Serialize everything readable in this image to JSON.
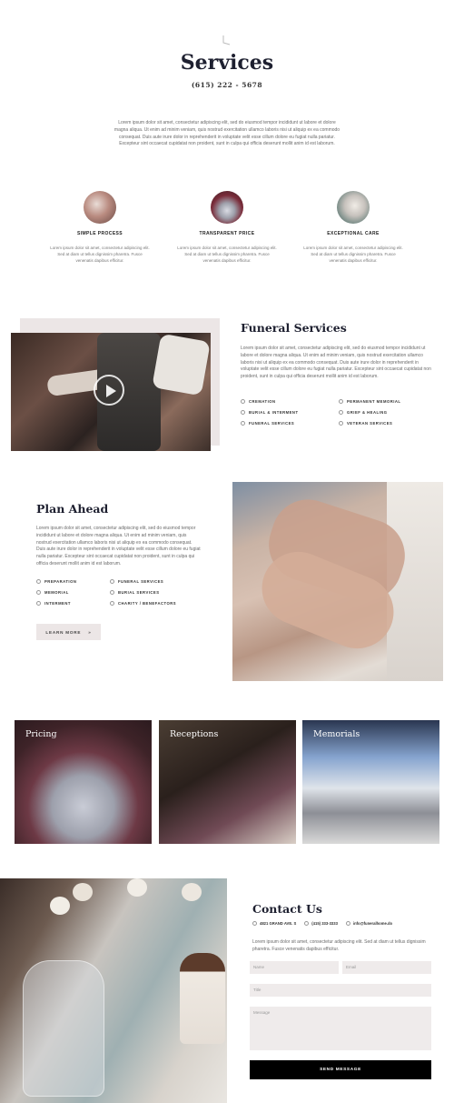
{
  "header": {
    "title": "Services",
    "phone": "(615) 222 - 5678",
    "intro": "Lorem ipsum dolor sit amet, consectetur adipiscing elit, sed do eiusmod tempor incididunt ut labore et dolore magna aliqua. Ut enim ad minim veniam, quis nostrud exercitation ullamco laboris nisi ut aliquip ex ea commodo consequat. Duis aute irure dolor in reprehenderit in voluptate velit esse cillum dolore eu fugiat nulla pariatur. Excepteur sint occaecat cupidatat non proident, sunt in culpa qui officia deserunt mollit anim id est laborum."
  },
  "features": [
    {
      "title": "SIMPLE PROCESS",
      "text": "Lorem ipsum dolor sit amet, consectetur adipiscing elit. Sed at diam ut tellus dignissim pharetra. Fusce venenatis dapibus efficitur."
    },
    {
      "title": "TRANSPARENT PRICE",
      "text": "Lorem ipsum dolor sit amet, consectetur adipiscing elit. Sed at diam ut tellus dignissim pharetra. Fusce venenatis dapibus efficitur."
    },
    {
      "title": "EXCEPTIONAL CARE",
      "text": "Lorem ipsum dolor sit amet, consectetur adipiscing elit. Sed at diam ut tellus dignissim pharetra. Fusce venenatis dapibus efficitur."
    }
  ],
  "funeral": {
    "title": "Funeral Services",
    "text": "Lorem ipsum dolor sit amet, consectetur adipiscing elit, sed do eiusmod tempor incididunt ut labore et dolore magna aliqua. Ut enim ad minim veniam, quis nostrud exercitation ullamco laboris nisi ut aliquip ex ea commodo consequat. Duis aute irure dolor in reprehenderit in voluptate velit esse cillum dolore eu fugiat nulla pariatur. Excepteur sint occaecat cupidatat non proident, sunt in culpa qui officia deserunt mollit anim id est laborum.",
    "services": [
      "CREMATION",
      "PERMANENT MEMORIAL",
      "BURIAL & INTERMENT",
      "GRIEF & HEALING",
      "FUNERAL SERVICES",
      "VETERAN SERVICES"
    ]
  },
  "plan": {
    "title": "Plan Ahead",
    "text": "Lorem ipsum dolor sit amet, consectetur adipiscing elit, sed do eiusmod tempor incididunt ut labore et dolore magna aliqua. Ut enim ad minim veniam, quis nostrud exercitation ullamco laboris nisi ut aliquip ex ea commodo consequat. Duis aute irure dolor in reprehenderit in voluptate velit esse cillum dolore eu fugiat nulla pariatur. Excepteur sint occaecat cupidatat non proident, sunt in culpa qui officia deserunt mollit anim id est laborum.",
    "items": [
      "PREPARATION",
      "FUNERAL SERVICES",
      "MEMORIAL",
      "BURIAL SERVICES",
      "INTERMENT",
      "CHARITY / BENEFACTORS"
    ],
    "button": "LEARN MORE",
    "button_arrow": "»"
  },
  "cards": [
    {
      "label": "Pricing"
    },
    {
      "label": "Receptions"
    },
    {
      "label": "Memorials"
    }
  ],
  "contact": {
    "title": "Contact Us",
    "address": "4821 GRAND AVE. S",
    "phone": "(415) 333-3333",
    "email": "info@funeralhome.do",
    "text": "Lorem ipsum dolor sit amet, consectetur adipiscing elit. Sed at diam ut tellus dignissim pharetra. Fusce venenatis dapibus efficitur.",
    "name_placeholder": "Name",
    "email_placeholder": "Email",
    "title_placeholder": "Title",
    "message_placeholder": "Message",
    "send": "SEND MESSAGE"
  }
}
